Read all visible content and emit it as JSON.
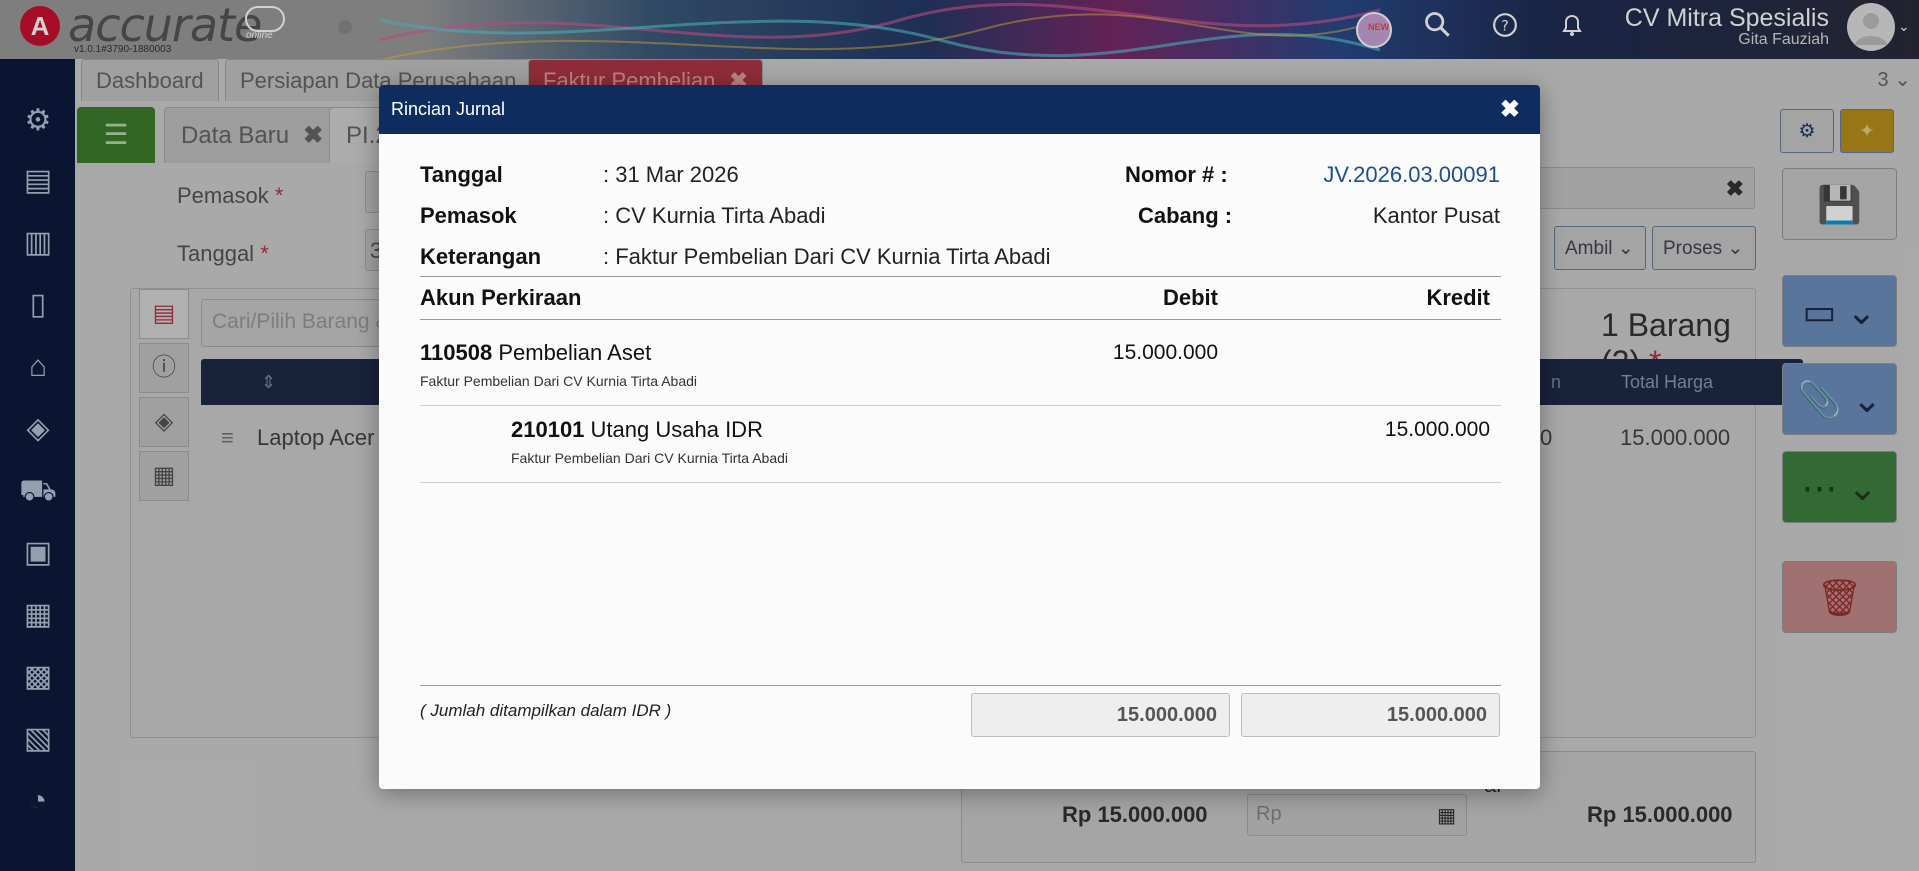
{
  "app": {
    "logo_text": "accurate",
    "logo_sub": "online",
    "version": "v1.0.1#3790-1880003",
    "new_badge": "NEW",
    "company_name": "CV Mitra Spesialis",
    "user_name": "Gita Fauziah"
  },
  "tabs": {
    "items": [
      {
        "label": "Dashboard"
      },
      {
        "label": "Persiapan Data Perusahaan"
      },
      {
        "label": "Faktur Pembelian"
      }
    ],
    "close_glyph": "✖",
    "counter": "3"
  },
  "subtabs": {
    "new": "Data Baru",
    "current": "PI.2"
  },
  "form": {
    "pemasok_label": "Pemasok",
    "tanggal_label": "Tanggal",
    "tanggal_value": "3",
    "required_mark": "*",
    "search_placeholder": "Cari/Pilih Barang & Jasa",
    "item_name": "Laptop Acer",
    "item_qty_tail": "0",
    "item_total": "15.000.000",
    "col_total_harga": "Total Harga",
    "col_partial": "n",
    "barang_count": "1 Barang (2)",
    "ambil_label": "Ambil",
    "proses_label": "Proses",
    "search_tail": "0",
    "footer_total_left": "Rp 15.000.000",
    "footer_rp_placeholder": "Rp",
    "footer_total_right": "Rp 15.000.000",
    "footer_partial_label": "al"
  },
  "modal": {
    "title": "Rincian Jurnal",
    "close": "✖",
    "tanggal_label": "Tanggal",
    "tanggal_value": ": 31 Mar 2026",
    "pemasok_label": "Pemasok",
    "pemasok_value": ": CV Kurnia Tirta Abadi",
    "keterangan_label": "Keterangan",
    "keterangan_value": ": Faktur Pembelian Dari CV Kurnia Tirta Abadi",
    "nomor_label": "Nomor # :",
    "nomor_value": "JV.2026.03.00091",
    "cabang_label": "Cabang :",
    "cabang_value": "Kantor Pusat",
    "col_akun": "Akun Perkiraan",
    "col_debit": "Debit",
    "col_kredit": "Kredit",
    "entries": [
      {
        "code": "110508",
        "name": "Pembelian Aset",
        "desc": "Faktur Pembelian Dari CV Kurnia Tirta Abadi",
        "debit": "15.000.000",
        "kredit": ""
      },
      {
        "code": "210101",
        "name": "Utang Usaha IDR",
        "desc": "Faktur Pembelian Dari CV Kurnia Tirta Abadi",
        "debit": "",
        "kredit": "15.000.000"
      }
    ],
    "note": "( Jumlah ditampilkan dalam IDR )",
    "total_debit": "15.000.000",
    "total_kredit": "15.000.000"
  },
  "colors": {
    "modal_header": "#0e2d5e",
    "nav_bg": "#0c1a3c",
    "active_tab": "#b03646",
    "journal_number": "#1f4e8c"
  }
}
